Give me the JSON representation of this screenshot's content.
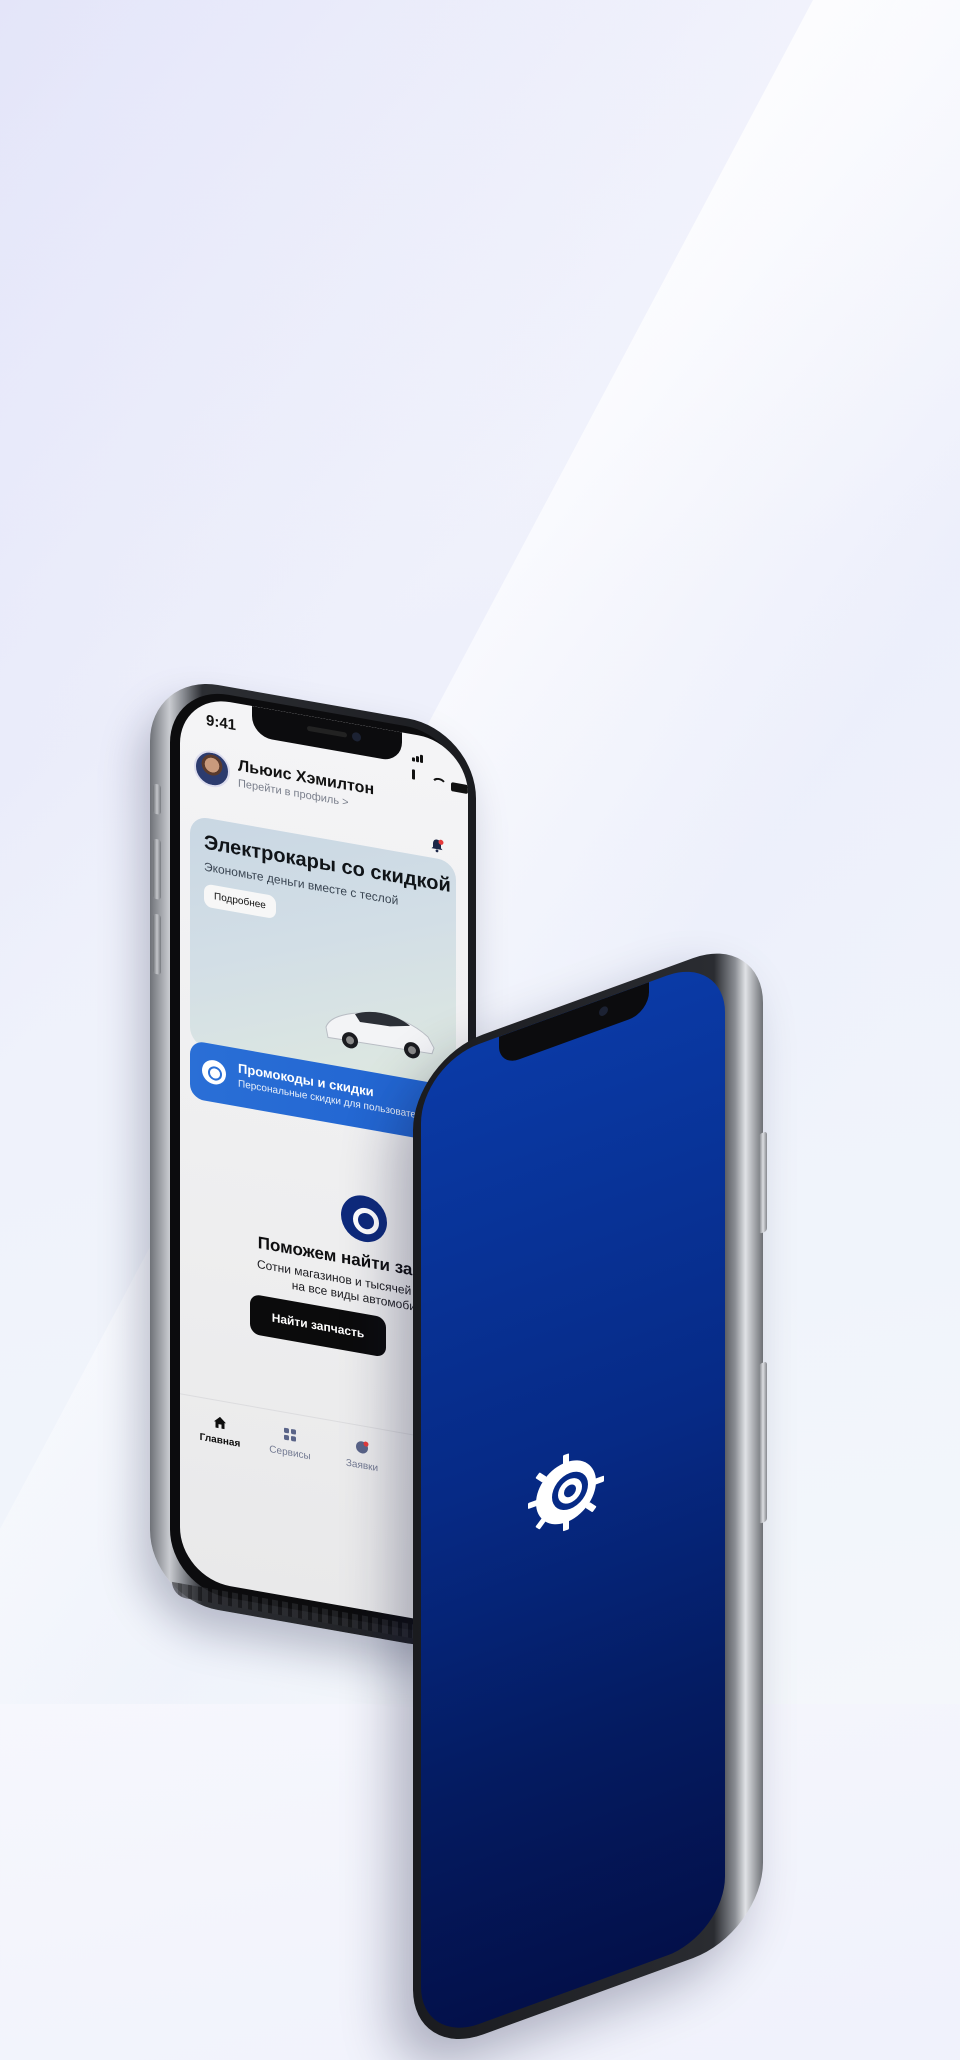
{
  "status_bar": {
    "time": "9:41"
  },
  "profile": {
    "name": "Льюис Хэмилтон",
    "link": "Перейти в профиль",
    "chevron": ">"
  },
  "icons": {
    "avatar": "avatar",
    "notification": "bell-icon",
    "discount": "percent-badge-icon",
    "logo": "gear-ring-logo-icon",
    "tabs": [
      "home-icon",
      "grid-icon",
      "requests-icon"
    ]
  },
  "promo": {
    "title": "Электрокары со скидкой",
    "subtitle": "Экономьте деньги вместе с теслой",
    "button": "Подробнее"
  },
  "discounts": {
    "title": "Промокоды и скидки",
    "subtitle": "Персональные скидки для пользователей Oppa"
  },
  "help": {
    "title": "Поможем найти запчасти",
    "subtitle_line1": "Сотни магазинов и тысячей запчастей",
    "subtitle_line2": "на все виды автомобилей",
    "button": "Найти запчасть"
  },
  "tabbar": {
    "items": [
      {
        "label": "Главная",
        "active": true
      },
      {
        "label": "Сервисы",
        "active": false
      },
      {
        "label": "Заявки",
        "active": false
      }
    ]
  },
  "colors": {
    "brand_blue": "#0e2a7c",
    "accent_blue": "#2a6fd6",
    "notification_dot": "#e53b3b",
    "splash_top": "#0a3aa6",
    "splash_bottom": "#03104a"
  }
}
